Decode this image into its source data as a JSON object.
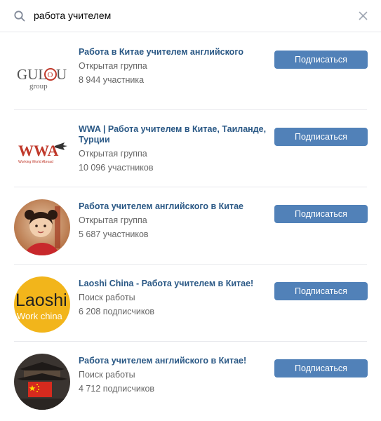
{
  "search": {
    "query": "работа учителем",
    "search_icon": "search-icon",
    "clear_icon": "close-icon"
  },
  "colors": {
    "link": "#2a5885",
    "button": "#5181b8",
    "secondary_text": "#656565",
    "divider": "#e7e8ec"
  },
  "groups": [
    {
      "title": "Работа в Китае учителем английского",
      "type": "Открытая группа",
      "count": "8 944 участника",
      "button": "Подписаться",
      "logo": {
        "main": "GUL",
        "badge": "O",
        "tail": "U",
        "sub": "group"
      }
    },
    {
      "title": "WWA | Работа учителем в Китае, Таиланде, Турции",
      "type": "Открытая группа",
      "count": "10 096 участников",
      "button": "Подписаться",
      "logo": {
        "main": "WWA",
        "sub": "Working World Abroad"
      }
    },
    {
      "title": "Работа учителем английского в Китае",
      "type": "Открытая группа",
      "count": "5 687 участников",
      "button": "Подписаться",
      "logo": {
        "description": "photo-child-avatar"
      }
    },
    {
      "title": "Laoshi China - Работа учителем в Китае!",
      "type": "Поиск работы",
      "count": "6 208 подписчиков",
      "button": "Подписаться",
      "logo": {
        "main": "Laoshi",
        "sub": "Work china"
      }
    },
    {
      "title": "Работа учителем английского в Китае!",
      "type": "Поиск работы",
      "count": "4 712 подписчиков",
      "button": "Подписаться",
      "logo": {
        "description": "china-flag-pagoda-avatar"
      }
    }
  ]
}
